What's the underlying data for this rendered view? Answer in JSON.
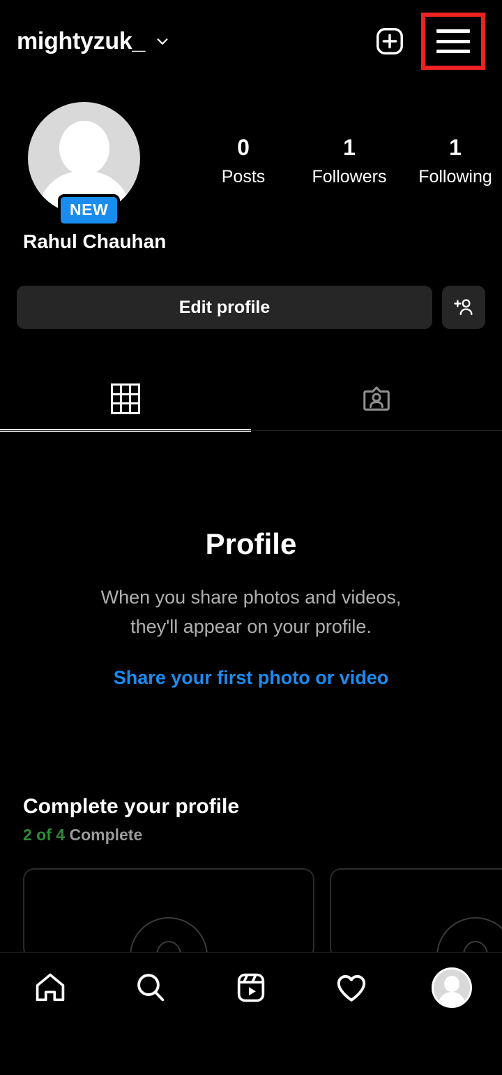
{
  "header": {
    "username": "mightyzuk_",
    "chevron_icon": "chevron-down-icon",
    "create_icon": "plus-square-icon",
    "menu_icon": "hamburger-menu-icon",
    "highlight_color": "#ee2222"
  },
  "profile": {
    "avatar_icon": "default-avatar-icon",
    "new_badge": "NEW",
    "badge_color": "#1a8cf0",
    "display_name": "Rahul Chauhan",
    "stats": [
      {
        "value": "0",
        "label": "Posts"
      },
      {
        "value": "1",
        "label": "Followers"
      },
      {
        "value": "1",
        "label": "Following"
      }
    ]
  },
  "actions": {
    "edit_profile_label": "Edit profile",
    "add_person_icon": "add-person-icon"
  },
  "tabs": [
    {
      "name": "grid",
      "icon": "grid-icon",
      "active": true
    },
    {
      "name": "tagged",
      "icon": "tagged-person-card-icon",
      "active": false
    }
  ],
  "empty_state": {
    "title": "Profile",
    "description_line1": "When you share photos and videos,",
    "description_line2": "they'll appear on your profile.",
    "link_label": "Share your first photo or video",
    "link_color": "#1a8cf0"
  },
  "complete_profile": {
    "title": "Complete your profile",
    "progress_count": "2 of 4",
    "progress_word": "Complete",
    "progress_color": "#2e8b37",
    "cards": [
      {
        "icon": "add-profile-photo-icon"
      },
      {
        "icon": "add-profile-photo-icon"
      }
    ]
  },
  "bottom_nav": [
    {
      "name": "home",
      "icon": "home-icon",
      "active": false
    },
    {
      "name": "search",
      "icon": "search-icon",
      "active": false
    },
    {
      "name": "reels",
      "icon": "reels-icon",
      "active": false
    },
    {
      "name": "activity",
      "icon": "heart-icon",
      "active": false
    },
    {
      "name": "profile",
      "icon": "profile-avatar-icon",
      "active": true
    }
  ]
}
